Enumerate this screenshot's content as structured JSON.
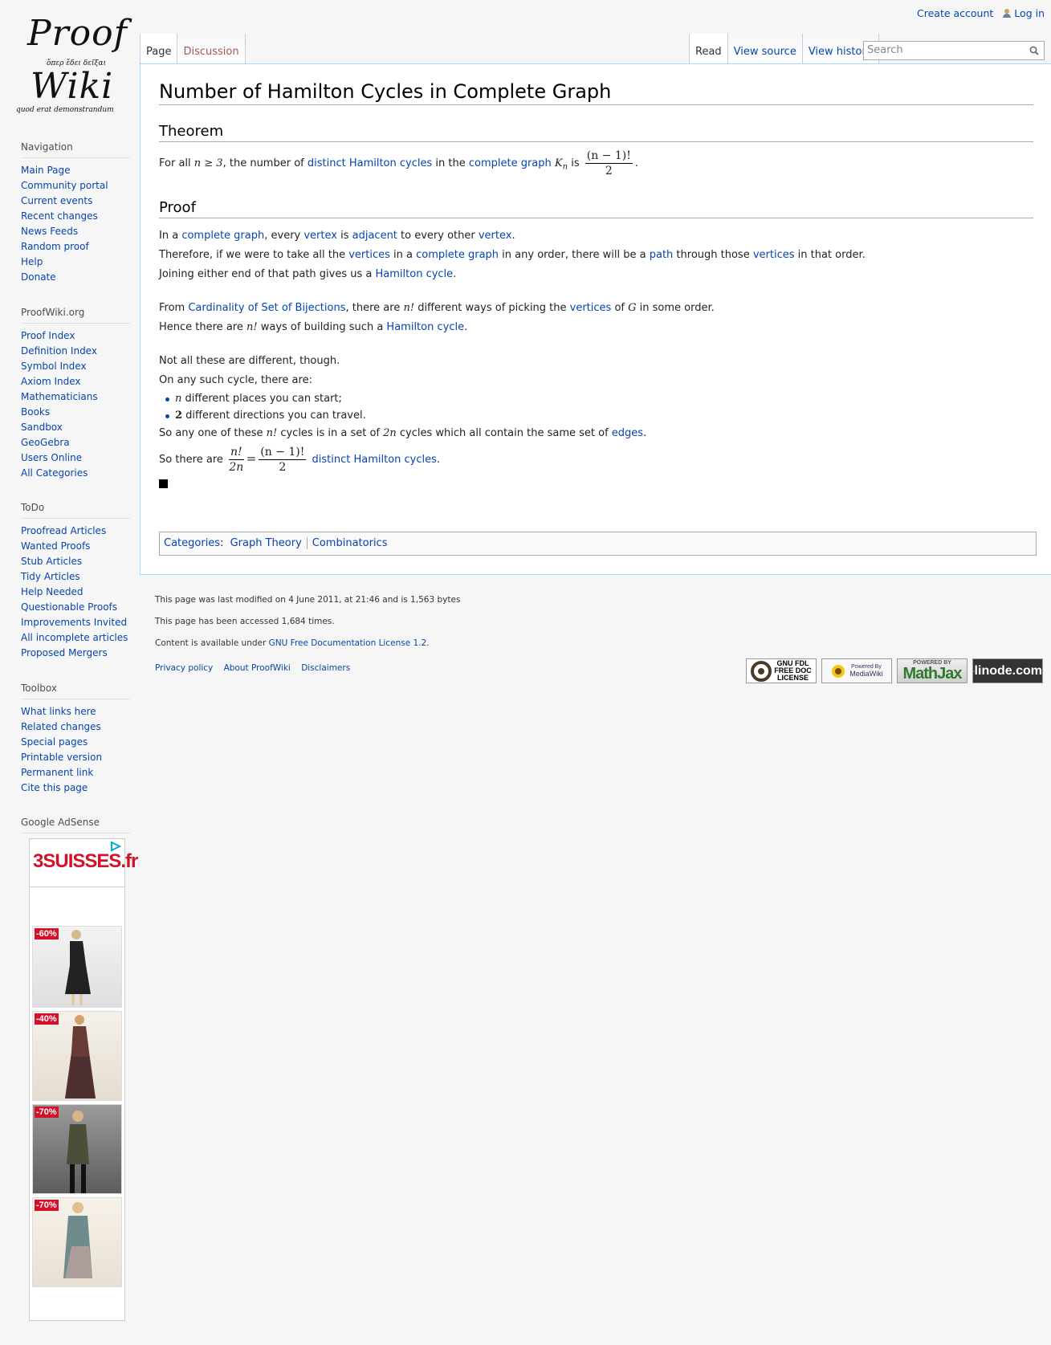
{
  "logo": {
    "line1": "Proof",
    "line1_greek": "ὅπερ ἔδει δεῖξαι",
    "line2": "Wiki",
    "line2_latin": "quod erat demonstrandum"
  },
  "personal": {
    "create_account": "Create account",
    "login": "Log in"
  },
  "tabs": {
    "left": [
      "Page",
      "Discussion"
    ],
    "right": [
      "Read",
      "View source",
      "View history"
    ]
  },
  "search": {
    "placeholder": "Search"
  },
  "article": {
    "title": "Number of Hamilton Cycles in Complete Graph",
    "theorem_heading": "Theorem",
    "proof_heading": "Proof",
    "theorem": {
      "t1": "For all ",
      "m1": "n ≥ 3",
      "t2": ", the number of ",
      "l1": "distinct Hamilton cycles",
      "t3": " in the ",
      "l2": "complete graph",
      "m2": "K",
      "m2sub": "n",
      "t4": " is ",
      "frac_num": "(n − 1)!",
      "frac_den": "2",
      "t5": "."
    },
    "proof": {
      "p1": {
        "t1": "In a ",
        "l1": "complete graph",
        "t2": ", every ",
        "l2": "vertex",
        "t3": " is ",
        "l3": "adjacent",
        "t4": " to every other ",
        "l4": "vertex",
        "t5": "."
      },
      "p2": {
        "t1": "Therefore, if we were to take all the ",
        "l1": "vertices",
        "t2": " in a ",
        "l2": "complete graph",
        "t3": " in any order, there will be a ",
        "l3": "path",
        "t4": " through those ",
        "l4": "vertices",
        "t5": " in that order."
      },
      "p3": {
        "t1": "Joining either end of that path gives us a ",
        "l1": "Hamilton cycle",
        "t2": "."
      },
      "p4": {
        "t1": "From ",
        "l1": "Cardinality of Set of Bijections",
        "t2": ", there are ",
        "m1": "n!",
        "t3": " different ways of picking the ",
        "l2": "vertices",
        "t4": " of ",
        "m2": "G",
        "t5": " in some order."
      },
      "p5": {
        "t1": "Hence there are ",
        "m1": "n!",
        "t2": " ways of building such a ",
        "l1": "Hamilton cycle",
        "t3": "."
      },
      "p6": "Not all these are different, though.",
      "p7": "On any such cycle, there are:",
      "bullets": [
        {
          "m": "n",
          "t": " different places you can start;"
        },
        {
          "m": "2",
          "t": " different directions you can travel."
        }
      ],
      "p8": {
        "t1": "So any one of these ",
        "m1": "n!",
        "t2": " cycles is in a set of ",
        "m2": "2n",
        "t3": " cycles which all contain the same set of ",
        "l1": "edges",
        "t4": "."
      },
      "p9": {
        "t1": "So there are ",
        "f1n": "n!",
        "f1d": "2n",
        "eq": "=",
        "f2n": "(n − 1)!",
        "f2d": "2",
        "l1": "distinct Hamilton cycles",
        "t2": "."
      }
    },
    "categories": {
      "label": "Categories",
      "items": [
        "Graph Theory",
        "Combinatorics"
      ]
    }
  },
  "sidebar": {
    "navigation": {
      "title": "Navigation",
      "items": [
        "Main Page",
        "Community portal",
        "Current events",
        "Recent changes",
        "News Feeds",
        "Random proof",
        "Help",
        "Donate"
      ]
    },
    "proofwiki": {
      "title": "ProofWiki.org",
      "items": [
        "Proof Index",
        "Definition Index",
        "Symbol Index",
        "Axiom Index",
        "Mathematicians",
        "Books",
        "Sandbox",
        "GeoGebra",
        "Users Online",
        "All Categories"
      ]
    },
    "todo": {
      "title": "ToDo",
      "items": [
        "Proofread Articles",
        "Wanted Proofs",
        "Stub Articles",
        "Tidy Articles",
        "Help Needed",
        "Questionable Proofs",
        "Improvements Invited",
        "All incomplete articles",
        "Proposed Mergers"
      ]
    },
    "toolbox": {
      "title": "Toolbox",
      "items": [
        "What links here",
        "Related changes",
        "Special pages",
        "Printable version",
        "Permanent link",
        "Cite this page"
      ]
    },
    "adsense": {
      "title": "Google AdSense"
    }
  },
  "ad": {
    "brand": "3SUISSES.fr",
    "badges": [
      "-60%",
      "-40%",
      "-70%",
      "-70%"
    ]
  },
  "footer": {
    "modified": "This page was last modified on 4 June 2011, at 21:46 and is 1,563 bytes",
    "accessed": "This page has been accessed 1,684 times.",
    "license_pre": "Content is available under ",
    "license_link": "GNU Free Documentation License 1.2",
    "license_post": ".",
    "places": [
      "Privacy policy",
      "About ProofWiki",
      "Disclaimers"
    ],
    "badges": {
      "gfdl": [
        "GNU FDL",
        "FREE DOC",
        "LICENSE"
      ],
      "mediawiki": [
        "Powered By",
        "MediaWiki"
      ],
      "mathjax_top": "POWERED BY",
      "mathjax": "MathJax",
      "linode": "linode.com"
    }
  }
}
